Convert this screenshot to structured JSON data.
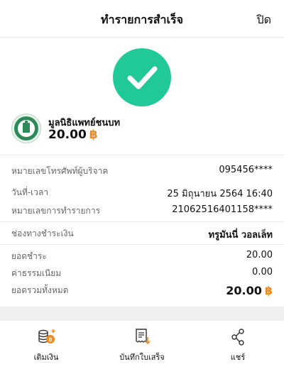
{
  "header": {
    "title": "ทำรายการสำเร็จ",
    "close_label": "ปิด"
  },
  "merchant": {
    "name": "มูลนิธิแพทย์ชนบท",
    "amount": "20.00",
    "currency_symbol": "฿"
  },
  "details": [
    {
      "label": "หมายเลขโทรศัพท์ผู้บริจาค",
      "value": "095456****"
    },
    {
      "label": "วันที่-เวลา",
      "value": "25 มิถุนายน 2564 16:40"
    },
    {
      "label": "หมายเลขการทำรายการ",
      "value": "21062516401158****"
    },
    {
      "label": "ช่องทางชำระเงิน",
      "value": "ทรูมันนี่ วอลเล็ท"
    },
    {
      "label": "ยอดชำระ",
      "value": "20.00"
    },
    {
      "label": "ค่าธรรมเนียม",
      "value": "0.00"
    },
    {
      "label": "ยอดรวมทั้งหมด",
      "value": "20.00",
      "currency_symbol": "฿"
    }
  ],
  "actions": [
    {
      "label": "เติมเงิน",
      "icon": "topup-coins-icon"
    },
    {
      "label": "บันทึกใบเสร็จ",
      "icon": "save-receipt-icon"
    },
    {
      "label": "แชร์",
      "icon": "share-icon"
    }
  ],
  "colors": {
    "success": "#20c997",
    "currency": "#f08a1c"
  }
}
